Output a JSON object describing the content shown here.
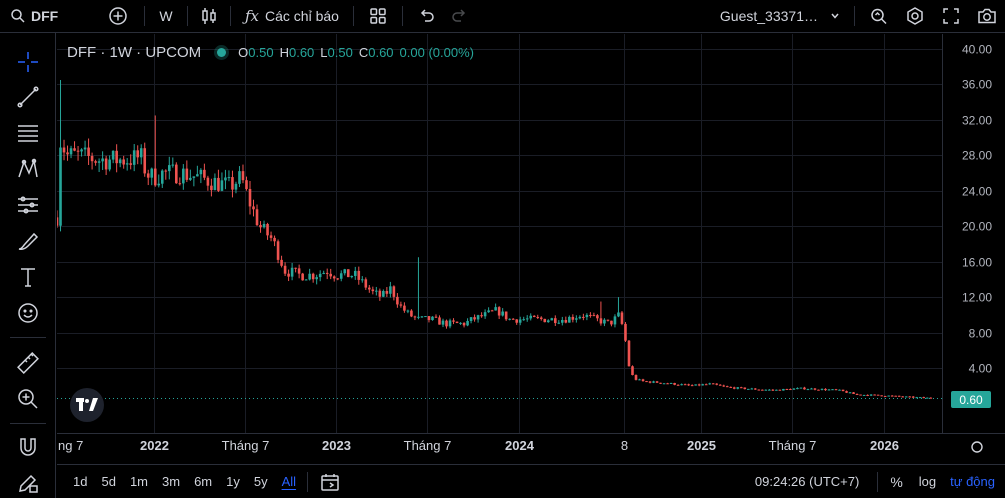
{
  "topbar": {
    "symbol": "DFF",
    "interval": "W",
    "indicators_label": "Các chỉ báo",
    "user": "Guest_33371…"
  },
  "legend": {
    "symbol": "DFF · 1W · UPCOM",
    "open_label": "O",
    "open": "0.50",
    "high_label": "H",
    "high": "0.60",
    "low_label": "L",
    "low": "0.50",
    "close_label": "C",
    "close": "0.60",
    "change": "0.00 (0.00%)"
  },
  "price_badge": "0.60",
  "bottombar": {
    "ranges": [
      "1d",
      "5d",
      "1m",
      "3m",
      "6m",
      "1y",
      "5y",
      "All"
    ],
    "active_range": "All",
    "time": "09:24:26 (UTC+7)",
    "percent_label": "%",
    "log_label": "log",
    "auto_label": "tự động"
  },
  "colors": {
    "up": "#26a69a",
    "down": "#ef5350",
    "accent": "#2962ff"
  },
  "chart_data": {
    "type": "candlestick",
    "y_ticks": [
      "40.00",
      "36.00",
      "32.00",
      "28.00",
      "24.00",
      "20.00",
      "16.00",
      "12.00",
      "8.00",
      "4.00"
    ],
    "y_tick_values": [
      40,
      36,
      32,
      28,
      24,
      20,
      16,
      12,
      8,
      4
    ],
    "x_ticks": [
      "ng 7",
      "2022",
      "Tháng 7",
      "2023",
      "Tháng 7",
      "2024",
      "8",
      "2025",
      "Tháng 7",
      "2026"
    ],
    "x_tick_bold": [
      false,
      true,
      false,
      true,
      false,
      true,
      false,
      true,
      false,
      true
    ],
    "x_tick_t": [
      2021.5,
      2022.0,
      2022.5,
      2023.0,
      2023.5,
      2024.0,
      2024.58,
      2025.0,
      2025.5,
      2026.0
    ],
    "x_range": [
      2021.47,
      2026.32
    ],
    "ylim": [
      -0.8,
      40.0
    ],
    "last_price": 0.6,
    "close_path": [
      [
        2021.47,
        21
      ],
      [
        2021.49,
        30
      ],
      [
        2021.52,
        28
      ],
      [
        2021.58,
        28
      ],
      [
        2021.7,
        27.5
      ],
      [
        2021.85,
        27.5
      ],
      [
        2021.93,
        27.8
      ],
      [
        2021.96,
        26
      ],
      [
        2022.0,
        25.5
      ],
      [
        2022.05,
        26
      ],
      [
        2022.15,
        26
      ],
      [
        2022.25,
        25.5
      ],
      [
        2022.33,
        25
      ],
      [
        2022.42,
        24.5
      ],
      [
        2022.48,
        25.5
      ],
      [
        2022.52,
        23
      ],
      [
        2022.58,
        20
      ],
      [
        2022.65,
        18.5
      ],
      [
        2022.72,
        15
      ],
      [
        2022.8,
        14.5
      ],
      [
        2022.88,
        14.5
      ],
      [
        2022.95,
        15
      ],
      [
        2023.0,
        14.5
      ],
      [
        2023.05,
        14.5
      ],
      [
        2023.1,
        14.5
      ],
      [
        2023.15,
        13.5
      ],
      [
        2023.2,
        12.5
      ],
      [
        2023.25,
        12
      ],
      [
        2023.3,
        13
      ],
      [
        2023.35,
        11
      ],
      [
        2023.4,
        10
      ],
      [
        2023.45,
        9.5
      ],
      [
        2023.52,
        9.5
      ],
      [
        2023.6,
        9
      ],
      [
        2023.7,
        9
      ],
      [
        2023.75,
        9.5
      ],
      [
        2023.82,
        10
      ],
      [
        2023.88,
        10.5
      ],
      [
        2023.95,
        9.5
      ],
      [
        2024.05,
        9.5
      ],
      [
        2024.15,
        9.5
      ],
      [
        2024.25,
        9.5
      ],
      [
        2024.35,
        10
      ],
      [
        2024.42,
        9.5
      ],
      [
        2024.5,
        9
      ],
      [
        2024.55,
        10
      ],
      [
        2024.58,
        8
      ],
      [
        2024.6,
        4.5
      ],
      [
        2024.63,
        2.8
      ],
      [
        2024.68,
        2.5
      ],
      [
        2024.8,
        2.3
      ],
      [
        2024.95,
        2.0
      ],
      [
        2025.05,
        2.2
      ],
      [
        2025.15,
        1.8
      ],
      [
        2025.3,
        1.6
      ],
      [
        2025.4,
        1.5
      ],
      [
        2025.55,
        1.7
      ],
      [
        2025.65,
        1.6
      ],
      [
        2025.75,
        1.5
      ],
      [
        2025.85,
        1.0
      ],
      [
        2026.0,
        0.9
      ],
      [
        2026.15,
        0.7
      ],
      [
        2026.27,
        0.6
      ]
    ],
    "spikes": [
      [
        2021.49,
        36.5
      ],
      [
        2022.0,
        32.5
      ],
      [
        2023.45,
        16.5
      ],
      [
        2024.45,
        11.5
      ],
      [
        2024.55,
        12
      ]
    ],
    "grid": true
  }
}
